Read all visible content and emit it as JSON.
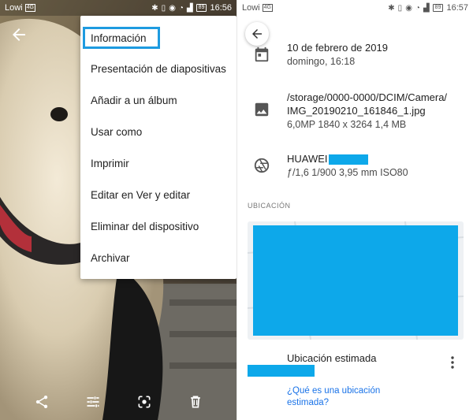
{
  "left_screen": {
    "status": {
      "carrier": "Lowi",
      "time": "16:56",
      "battery": "89"
    },
    "menu": {
      "items": [
        {
          "label": "Información",
          "highlighted": true
        },
        {
          "label": "Presentación de diapositivas"
        },
        {
          "label": "Añadir a un álbum"
        },
        {
          "label": "Usar como"
        },
        {
          "label": "Imprimir"
        },
        {
          "label": "Editar en Ver y editar"
        },
        {
          "label": "Eliminar del dispositivo"
        },
        {
          "label": "Archivar"
        }
      ]
    },
    "bottom_actions": [
      "share-icon",
      "edit-adjust-icon",
      "lens-icon",
      "delete-icon"
    ]
  },
  "right_screen": {
    "status": {
      "carrier": "Lowi",
      "time": "16:57",
      "battery": "89"
    },
    "date": {
      "line1": "10 de febrero de 2019",
      "line2": "domingo, 16:18"
    },
    "file": {
      "path_line1": "/storage/0000-0000/DCIM/Camera/",
      "path_line2": "IMG_20190210_161846_1.jpg",
      "details": "6,0MP    1840 x 3264    1,4 MB"
    },
    "camera": {
      "brand": "HUAWEI",
      "details": "ƒ/1,6    1/900    3,95 mm    ISO80"
    },
    "location": {
      "section_label": "UBICACIÓN",
      "estimated_label": "Ubicación estimada",
      "help_link_line1": "¿Qué es una ubicación",
      "help_link_line2": "estimada?"
    },
    "colors": {
      "redaction": "#0da8ea",
      "highlight": "#1e9be0",
      "link": "#1a73e8"
    }
  }
}
